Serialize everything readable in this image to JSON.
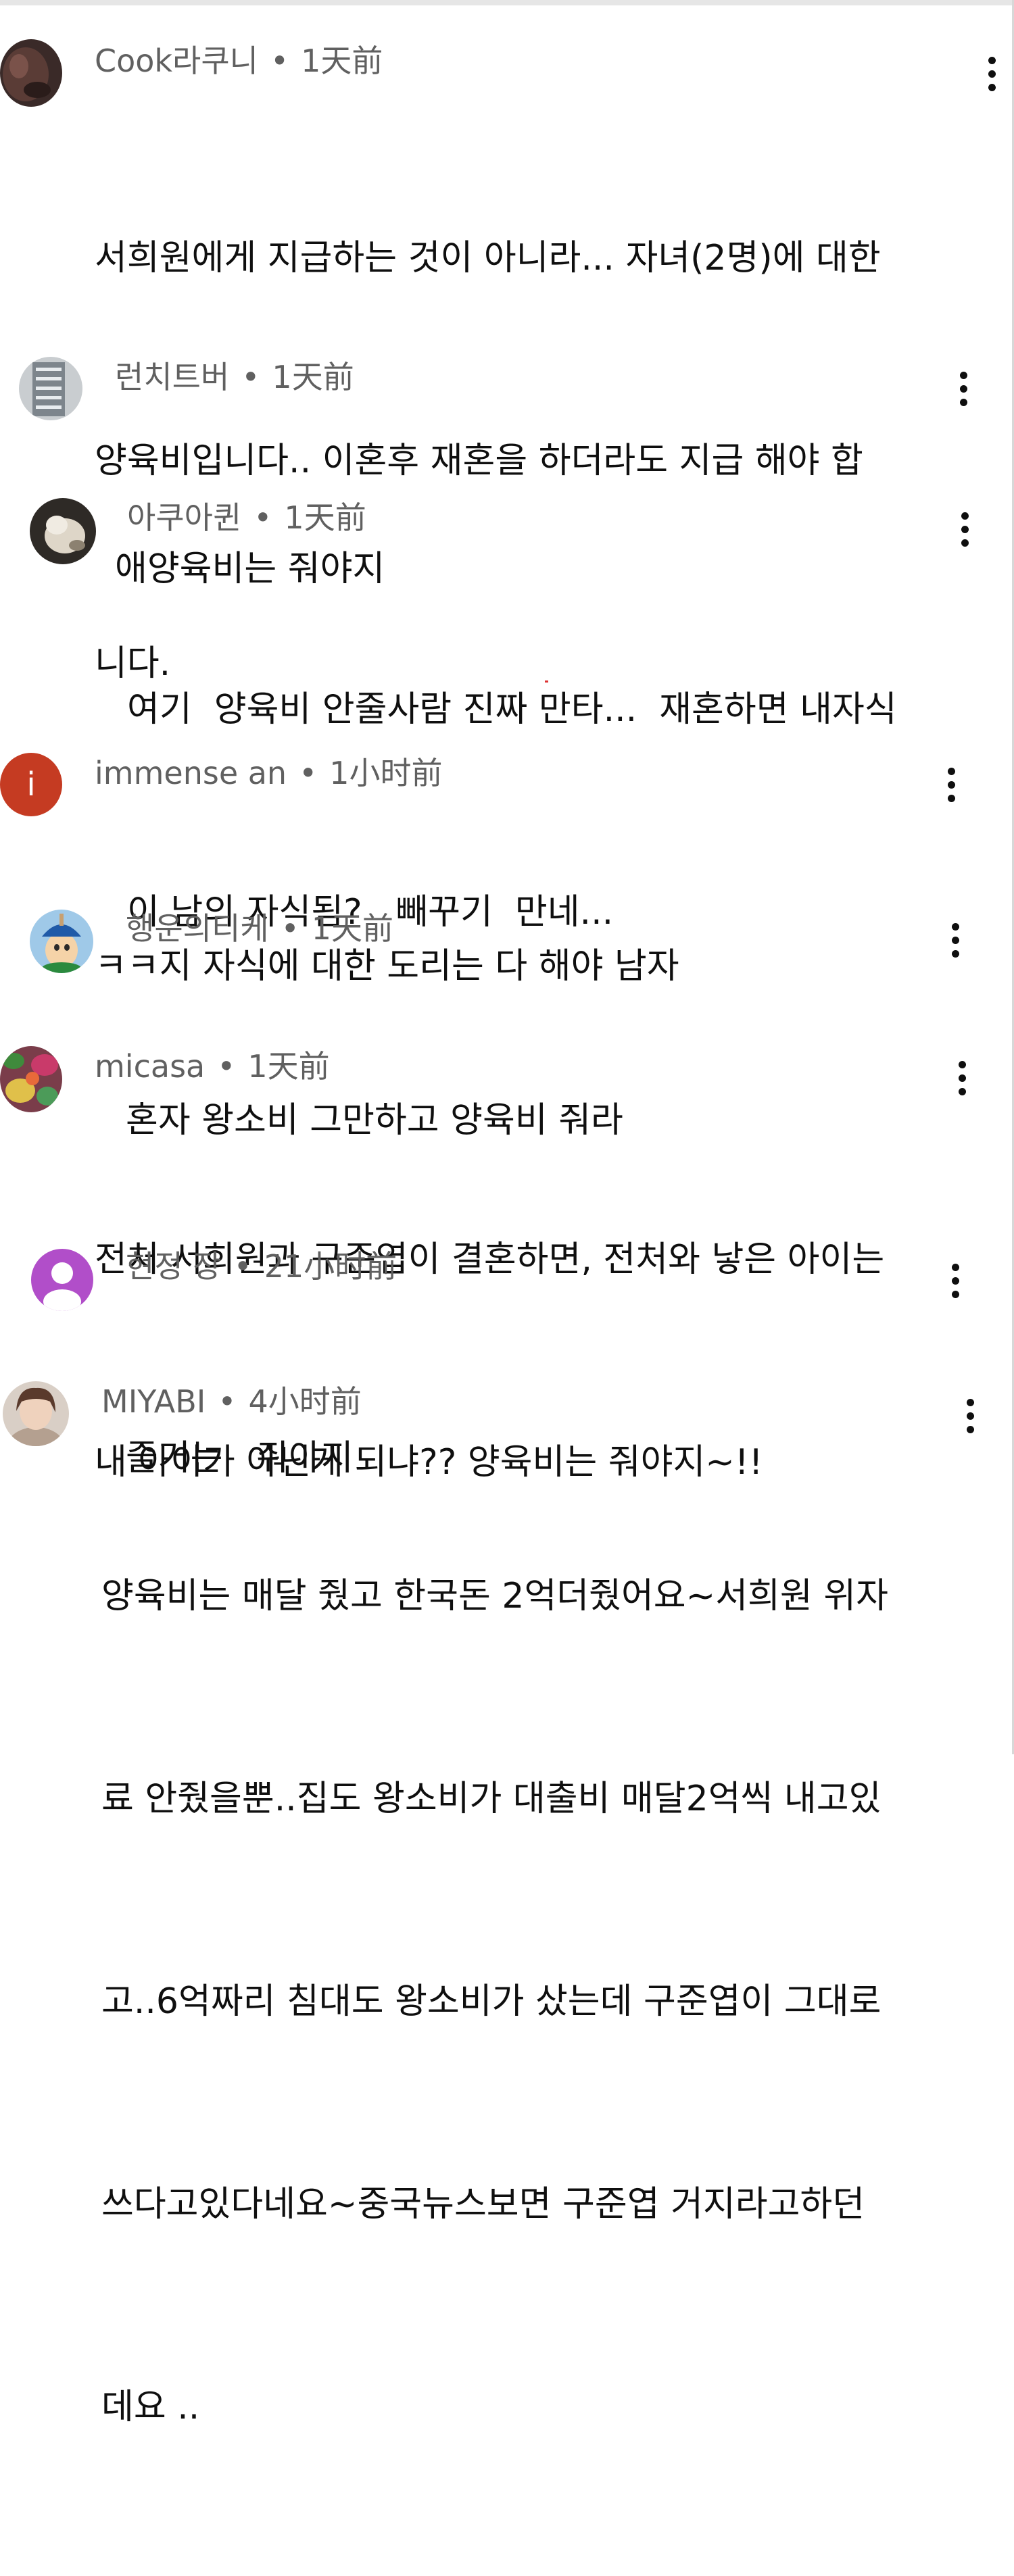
{
  "comments": [
    {
      "author": "Cook라쿠니",
      "time": "1天前",
      "lines": [
        "서희원에게 지급하는 것이 아니라... 자녀(2명)에 대한",
        "양육비입니다.. 이혼후 재혼을 하더라도 지급 해야 합",
        "니다."
      ]
    },
    {
      "author": "런치트버",
      "time": "1天前",
      "lines": [
        "애양육비는 줘야지"
      ]
    },
    {
      "author": "아쿠아퀸",
      "time": "1天前",
      "lines": [
        "여기  양육비 안줄사람 진짜 만타...  재혼하면 내자식",
        "이 남의 자식됨?   빼꾸기  만네..."
      ]
    },
    {
      "author": "immense an",
      "time": "1小时前",
      "avatar_letter": "i",
      "lines": [
        "ㅋㅋ지 자식에 대한 도리는 다 해야 남자"
      ]
    },
    {
      "author": "행운의티케",
      "time": "1天前",
      "lines": [
        "혼자 왕소비 그만하고 양육비 줘라"
      ]
    },
    {
      "author": "micasa",
      "time": "1天前",
      "lines": [
        "전처 서희원과 구준엽이 결혼하면, 전처와 낳은 아이는",
        "내 아이가 아닌게 되냐?? 양육비는 줘야지~!!"
      ]
    },
    {
      "author": "현정 장",
      "time": "21小时前",
      "lines": [
        "줄거는   줘야지"
      ]
    },
    {
      "author": "MIYABI",
      "time": "4小时前",
      "lines": [
        "양육비는 매달 줬고 한국돈 2억더줬어요~서희원 위자",
        "료 안줬을뿐..집도 왕소비가 대출비 매달2억씩 내고있",
        "고..6억짜리 침대도 왕소비가 샀는데 구준엽이 그대로",
        "쓰다고있다네요~중국뉴스보면 구준엽 거지라고하던",
        "데요 .."
      ]
    }
  ],
  "colors": {
    "meta_text": "#606060",
    "body_text": "#0f0f0f",
    "avatar_immense": "#c53b22",
    "avatar_hyunjung": "#b14ec9"
  },
  "icons": [
    "more-vert-icon",
    "person-silhouette-icon"
  ]
}
